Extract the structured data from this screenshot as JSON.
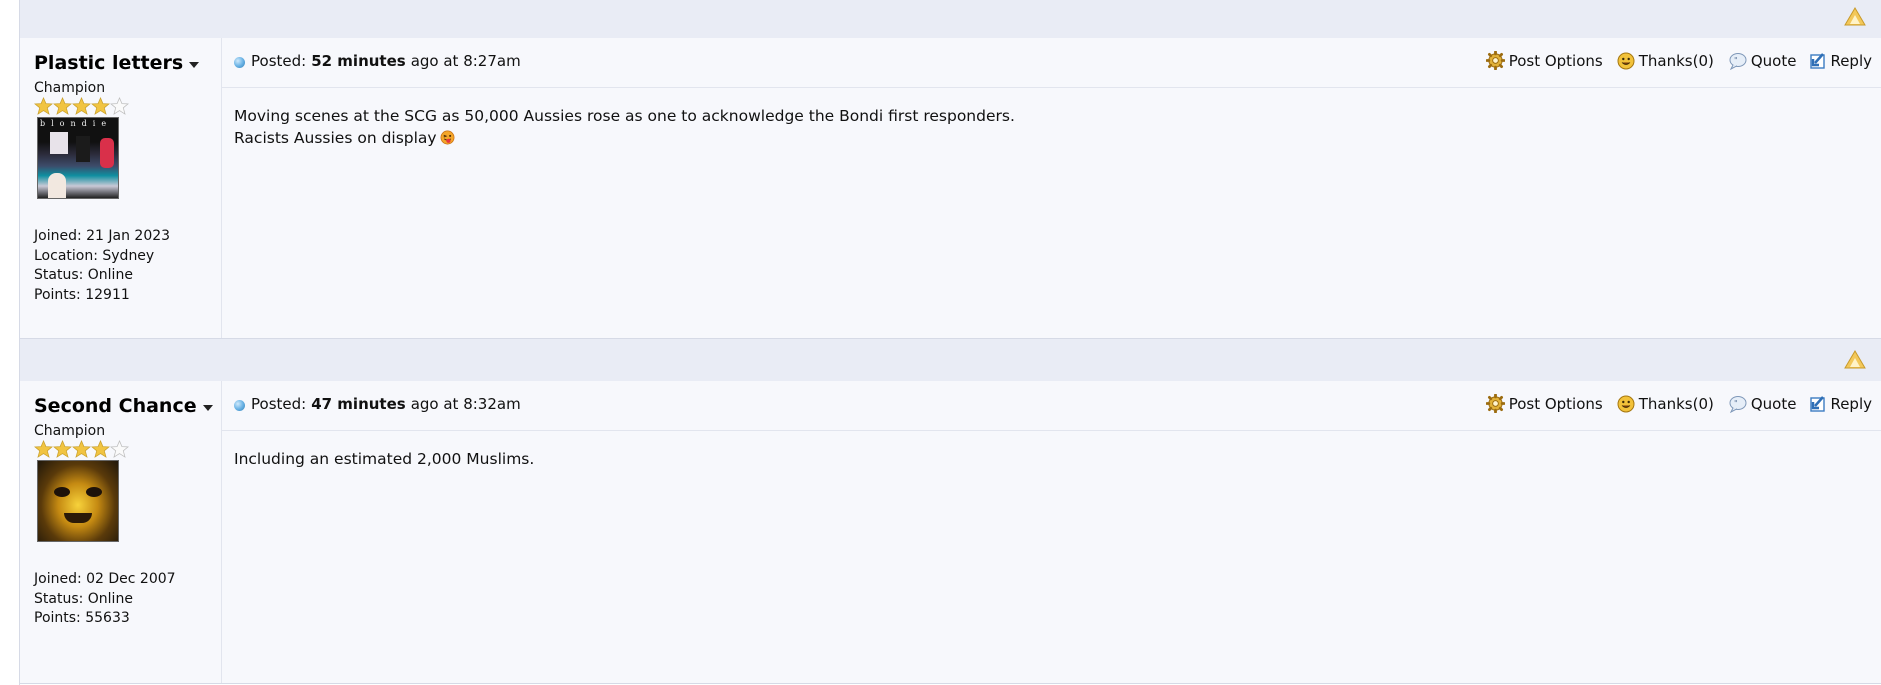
{
  "posts": [
    {
      "author": "Plastic letters",
      "rank": "Champion",
      "stars_filled": 4,
      "stars_total": 5,
      "meta": {
        "joined": "Joined: 21 Jan 2023",
        "location": "Location: Sydney",
        "status": "Status: Online",
        "points": "Points: 12911"
      },
      "posted_label": "Posted:",
      "posted_age": "52 minutes",
      "posted_rest": "ago at 8:27am",
      "content_lines": [
        "Moving scenes at the SCG as 50,000 Aussies rose as one to acknowledge the Bondi first responders.",
        "Racists Aussies on display"
      ]
    },
    {
      "author": "Second Chance",
      "rank": "Champion",
      "stars_filled": 4,
      "stars_total": 5,
      "meta": {
        "joined": "Joined: 02 Dec 2007",
        "status": "Status: Online",
        "points": "Points: 55633"
      },
      "posted_label": "Posted:",
      "posted_age": "47 minutes",
      "posted_rest": "ago at 8:32am",
      "content_lines": [
        "Including an estimated 2,000 Muslims."
      ]
    }
  ],
  "actions": {
    "post_options": "Post Options",
    "thanks": "Thanks(0)",
    "quote": "Quote",
    "reply": "Reply"
  },
  "avatar_text": "blondie",
  "icons": {
    "back_to_top": "up-arrow-icon",
    "post_options": "gear-icon",
    "thanks": "smiley-icon",
    "quote": "quote-bubble-icon",
    "reply": "reply-arrow-icon",
    "posted": "blue-dot-icon",
    "emoji": "tongue-out-emoji-icon"
  },
  "colors": {
    "bar": "#e9ecf5",
    "post_bg": "#f7f8fc",
    "star": "#f1c441",
    "gear": "#d9a12a",
    "accent_blue": "#2f7fb8"
  }
}
